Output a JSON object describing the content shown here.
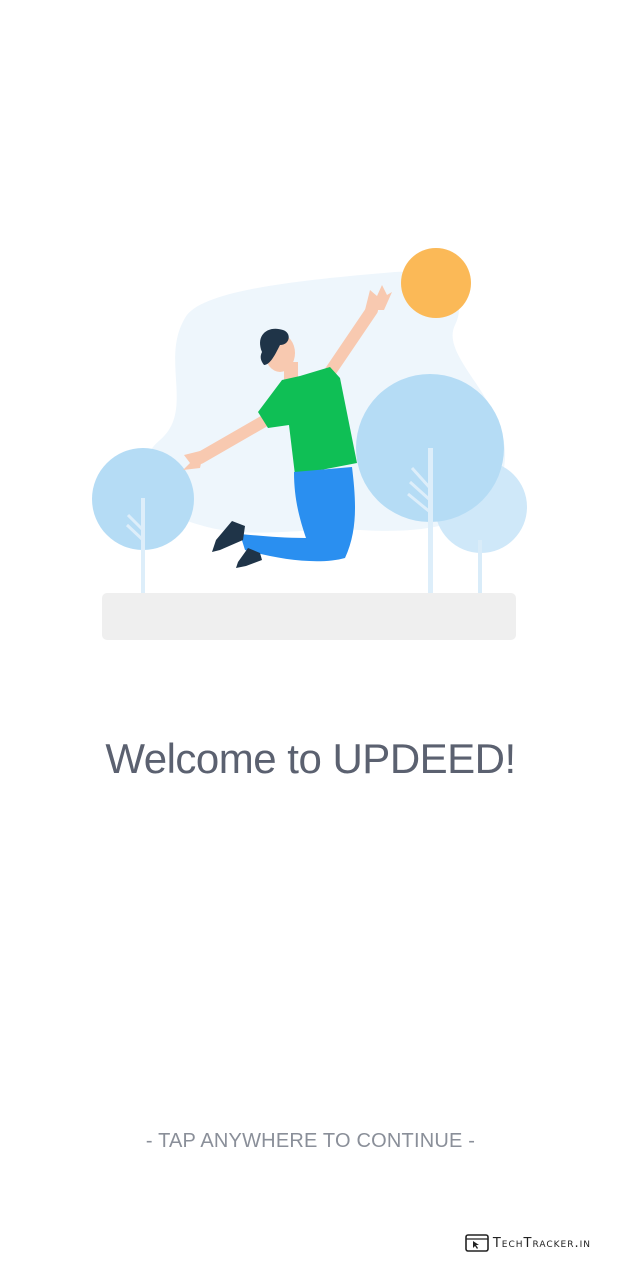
{
  "welcome": {
    "title": "Welcome to UPDEED!"
  },
  "hint": {
    "text": "- TAP ANYWHERE TO CONTINUE -"
  },
  "watermark": {
    "text": "TechTracker.in"
  },
  "colors": {
    "title": "#5b6170",
    "hint": "#8a8f99",
    "sun": "#fbb957",
    "shirt": "#0fbf55",
    "pants": "#2a8ff0",
    "tree": "#b5dcf5",
    "ground": "#efefef"
  }
}
